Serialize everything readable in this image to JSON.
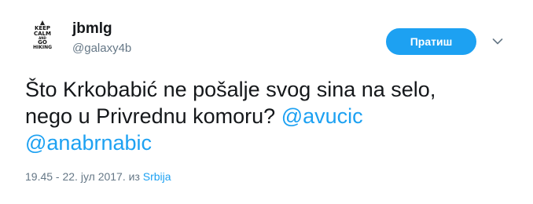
{
  "user": {
    "display_name": "jbmlg",
    "handle": "@galaxy4b",
    "avatar_text": [
      "KEEP",
      "CALM",
      "AND",
      "GO",
      "HIKING"
    ]
  },
  "follow_button": {
    "label": "Пратиш",
    "color": "#1da1f2"
  },
  "more_icon": "chevron-down-icon",
  "tweet": {
    "line1": "Što Krkobabić ne pošalje svog sina na selo,",
    "line2_text": "nego u Privrednu komoru? ",
    "mention1": "@avucic",
    "mention2": "@anabrnabic"
  },
  "meta": {
    "timestamp": "19.45 - 22. јул 2017.",
    "from_label": "из",
    "source": "Srbija"
  }
}
